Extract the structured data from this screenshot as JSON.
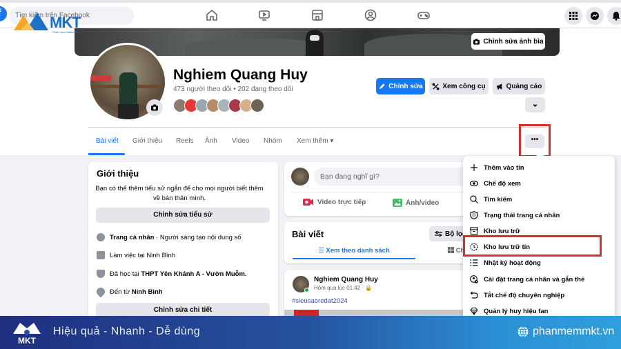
{
  "topnav": {
    "search_placeholder": "Tìm kiếm trên Facebook",
    "nav_icons": [
      "home-icon",
      "watch-icon",
      "marketplace-icon",
      "groups-icon",
      "gaming-icon"
    ],
    "right_icons": [
      "menu-grid-icon",
      "messenger-icon",
      "notifications-icon"
    ]
  },
  "watermark": {
    "brand": "MKT",
    "tagline": "Phần mềm Marketing"
  },
  "profile": {
    "cover_button": "Chỉnh sửa ảnh bìa",
    "name": "Nghiem Quang Huy",
    "follow_stats": "473 người theo dõi • 202 đang theo dõi",
    "friend_avatar_colors": [
      "#8a7c6e",
      "#e53935",
      "#9aa7b0",
      "#b98a6a",
      "#a7b4b8",
      "#a63a48",
      "#d6b08e",
      "#6e6254"
    ],
    "buttons": {
      "edit": "Chỉnh sửa",
      "tools": "Xem công cụ",
      "ads": "Quảng cáo"
    },
    "accent_color": "#1877f2"
  },
  "tabs": [
    {
      "label": "Bài viết",
      "active": true
    },
    {
      "label": "Giới thiệu",
      "active": false
    },
    {
      "label": "Reels",
      "active": false
    },
    {
      "label": "Ảnh",
      "active": false
    },
    {
      "label": "Video",
      "active": false
    },
    {
      "label": "Nhóm",
      "active": false
    },
    {
      "label": "Xem thêm ▾",
      "active": false
    }
  ],
  "more_button": "•••",
  "intro": {
    "title": "Giới thiệu",
    "description": "Bạn có thể thêm tiểu sử ngắn để cho mọi người biết thêm về bản thân mình.",
    "edit_bio": "Chỉnh sửa tiểu sử",
    "rows": [
      {
        "bold": "Trang cá nhân",
        "text": " · Người sáng tạo nội dung số"
      },
      {
        "bold": "",
        "text": "Làm việc tại Ninh Bình"
      },
      {
        "prefix": "Đã học tại ",
        "bold": "THPT Yên Khánh A - Vườn Muỗm."
      },
      {
        "prefix": "Đến từ ",
        "bold": "Ninh Bình"
      }
    ],
    "edit_details": "Chỉnh sửa chi tiết"
  },
  "composer": {
    "placeholder": "Bạn đang nghĩ gì?",
    "live_video": "Video trực tiếp",
    "photo_video": "Ảnh/video"
  },
  "posts": {
    "title": "Bài viết",
    "filter": "Bộ lọc",
    "list_view": "☰ Xem theo danh sách",
    "grid_view": "Chế độ xem lưới",
    "grid_view_visible": "Ch",
    "post": {
      "author": "Nghiem Quang Huy",
      "time": "Hôm qua lúc 01:42 · 🔒",
      "hashtag": "#sieusaoredat2024"
    }
  },
  "dropdown": {
    "items": [
      {
        "label": "Thêm vào tin",
        "icon": "plus-icon"
      },
      {
        "label": "Chế độ xem",
        "icon": "eye-icon"
      },
      {
        "label": "Tìm kiếm",
        "icon": "search-icon"
      },
      {
        "label": "Trạng thái trang cá nhân",
        "icon": "shield-icon"
      },
      {
        "label": "Kho lưu trữ",
        "icon": "archive-icon"
      },
      {
        "label": "Kho lưu trữ tin",
        "icon": "story-archive-icon",
        "highlighted": true
      },
      {
        "label": "Nhật ký hoạt động",
        "icon": "activity-log-icon"
      },
      {
        "label": "Cài đặt trang cá nhân và gắn thẻ",
        "icon": "profile-settings-icon"
      },
      {
        "label": "Tắt chế độ chuyên nghiệp",
        "icon": "undo-icon"
      },
      {
        "label": "Quản lý huy hiệu fan",
        "icon": "diamond-icon"
      }
    ],
    "highlight_color": "#d32f2f"
  },
  "banner": {
    "logo_text": "MKT",
    "slogan": "Hiệu quả - Nhanh  - Dễ dùng",
    "website": "phanmemmkt.vn"
  }
}
